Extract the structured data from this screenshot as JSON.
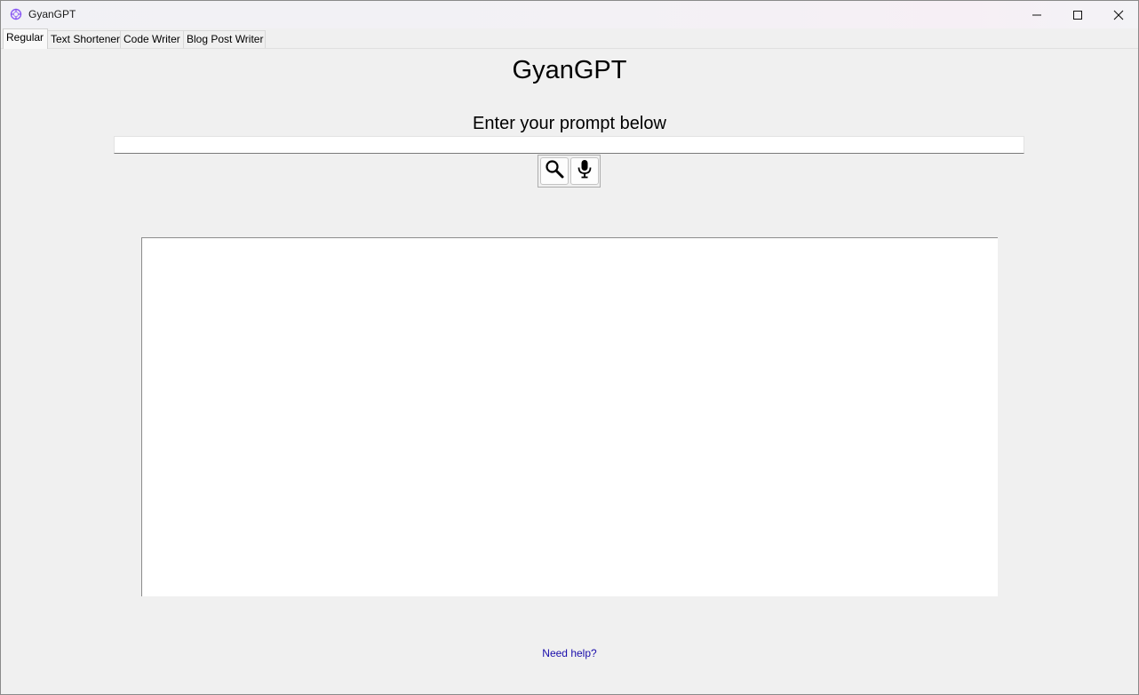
{
  "window": {
    "title": "GyanGPT",
    "icon": "gyangpt-logo-icon",
    "controls": {
      "minimize": "minimize-icon",
      "maximize": "maximize-icon",
      "close": "close-icon"
    }
  },
  "tabs": [
    {
      "label": "Regular",
      "active": true
    },
    {
      "label": "Text Shortener",
      "active": false
    },
    {
      "label": "Code Writer",
      "active": false
    },
    {
      "label": "Blog Post Writer",
      "active": false
    }
  ],
  "main": {
    "heading": "GyanGPT",
    "prompt_label": "Enter your prompt below",
    "prompt_value": "",
    "search_icon": "search-icon",
    "mic_icon": "microphone-icon",
    "output_text": "",
    "help_link": "Need help?"
  },
  "colors": {
    "window_bg": "#f0f0f0",
    "link": "#1a0dab",
    "logo": "#8b5cf6"
  }
}
